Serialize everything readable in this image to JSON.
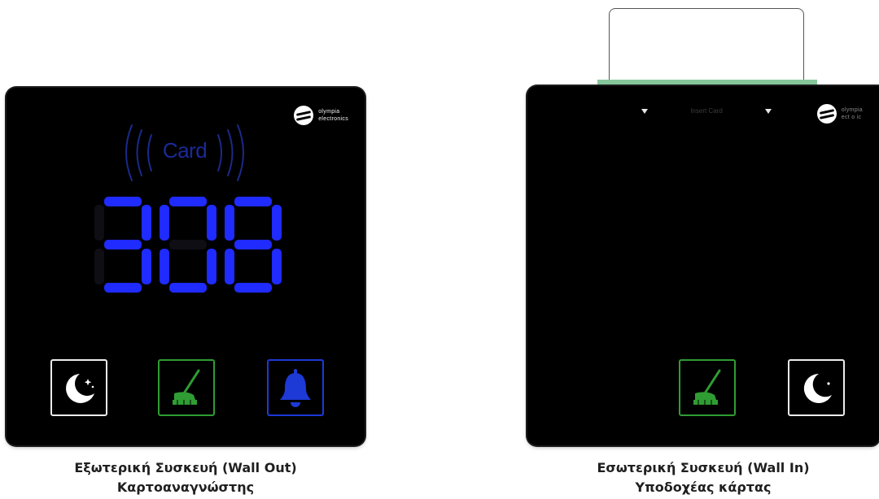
{
  "wall_out": {
    "brand": {
      "line1": "olympia",
      "line2": "electronics"
    },
    "card_label": "Card",
    "room_number": "308",
    "buttons": [
      {
        "name": "do-not-disturb",
        "icon": "moon-stars-icon",
        "color": "#ececec"
      },
      {
        "name": "make-up-room",
        "icon": "broom-icon",
        "color": "#2f9d33"
      },
      {
        "name": "doorbell",
        "icon": "bell-icon",
        "color": "#1d39d6"
      }
    ],
    "caption_line1": "Εξωτερική Συσκευή (Wall Out)",
    "caption_line2": "Καρτοαναγνώστης"
  },
  "wall_in": {
    "brand": {
      "line1": "olympia",
      "line2": "ect o ic"
    },
    "insert_label": "Insert Card",
    "buttons": [
      {
        "name": "make-up-room",
        "icon": "broom-icon",
        "color": "#2f9d33"
      },
      {
        "name": "do-not-disturb",
        "icon": "moon-star-icon",
        "color": "#ececec"
      }
    ],
    "caption_line1": "Εσωτερική Συσκευή (Wall In)",
    "caption_line2": "Υποδοχέας κάρτας"
  },
  "colors": {
    "panel": "#000000",
    "segment_blue": "#1f2bff",
    "accent_green": "#2f9d33",
    "slot_green": "#86c79b"
  }
}
